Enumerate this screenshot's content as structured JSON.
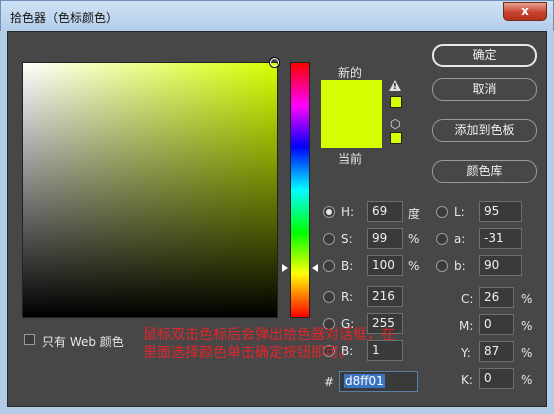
{
  "window": {
    "title": "拾色器（色标颜色）",
    "close_glyph": "x"
  },
  "swatches": {
    "new_label": "新的",
    "current_label": "当前",
    "new_color": "#d8ff01",
    "current_color": "#d8ff01"
  },
  "buttons": {
    "ok": "确定",
    "cancel": "取消",
    "add_to_swatches": "添加到色板",
    "color_libraries": "颜色库"
  },
  "hsb": {
    "h": {
      "label": "H:",
      "value": "69",
      "unit": "度"
    },
    "s": {
      "label": "S:",
      "value": "99",
      "unit": "%"
    },
    "b": {
      "label": "B:",
      "value": "100",
      "unit": "%"
    }
  },
  "rgb": {
    "r": {
      "label": "R:",
      "value": "216"
    },
    "g": {
      "label": "G:",
      "value": "255"
    },
    "b": {
      "label": "B:",
      "value": "1"
    }
  },
  "lab": {
    "l": {
      "label": "L:",
      "value": "95"
    },
    "a": {
      "label": "a:",
      "value": "-31"
    },
    "b": {
      "label": "b:",
      "value": "90"
    }
  },
  "cmyk": {
    "c": {
      "label": "C:",
      "value": "26",
      "unit": "%"
    },
    "m": {
      "label": "M:",
      "value": "0",
      "unit": "%"
    },
    "y": {
      "label": "Y:",
      "value": "87",
      "unit": "%"
    },
    "k": {
      "label": "K:",
      "value": "0",
      "unit": "%"
    }
  },
  "hex": {
    "label": "#",
    "value": "d8ff01"
  },
  "web_only": {
    "label": "只有 Web 颜色",
    "checked": false
  },
  "annotation": "鼠标双击色标后会弹出拾色器对话框，在里面选择颜色单击确定按钮即可。",
  "icons": {
    "warning": "warning-triangle-icon",
    "web_safe": "cube-icon"
  }
}
